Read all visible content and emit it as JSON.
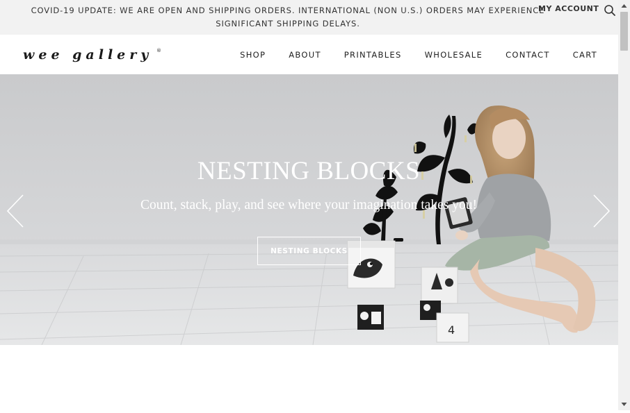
{
  "announcement": {
    "line1": "COVID-19 UPDATE: WE ARE OPEN AND SHIPPING ORDERS. INTERNATIONAL (NON U.S.) ORDERS MAY EXPERIENCE",
    "line2": "SIGNIFICANT SHIPPING DELAYS."
  },
  "account": {
    "label": "MY ACCOUNT"
  },
  "brand": {
    "logo_text": "wee gallery",
    "logo_mark": "®"
  },
  "nav": {
    "shop": "SHOP",
    "about": "ABOUT",
    "printables": "PRINTABLES",
    "wholesale": "WHOLESALE",
    "contact": "CONTACT",
    "cart": "CART"
  },
  "hero": {
    "title": "NESTING BLOCKS",
    "subtitle": "Count, stack, play, and see where your imagination takes you!",
    "cta_label": "NESTING BLOCKS",
    "image_alt": "Child playing with nesting blocks"
  },
  "icons": {
    "search": "search-icon",
    "prev": "chevron-left-icon",
    "next": "chevron-right-icon"
  },
  "colors": {
    "topbar_bg": "#f2f2f2",
    "text": "#333333",
    "hero_bg": "#cfd0d2",
    "white": "#ffffff"
  }
}
